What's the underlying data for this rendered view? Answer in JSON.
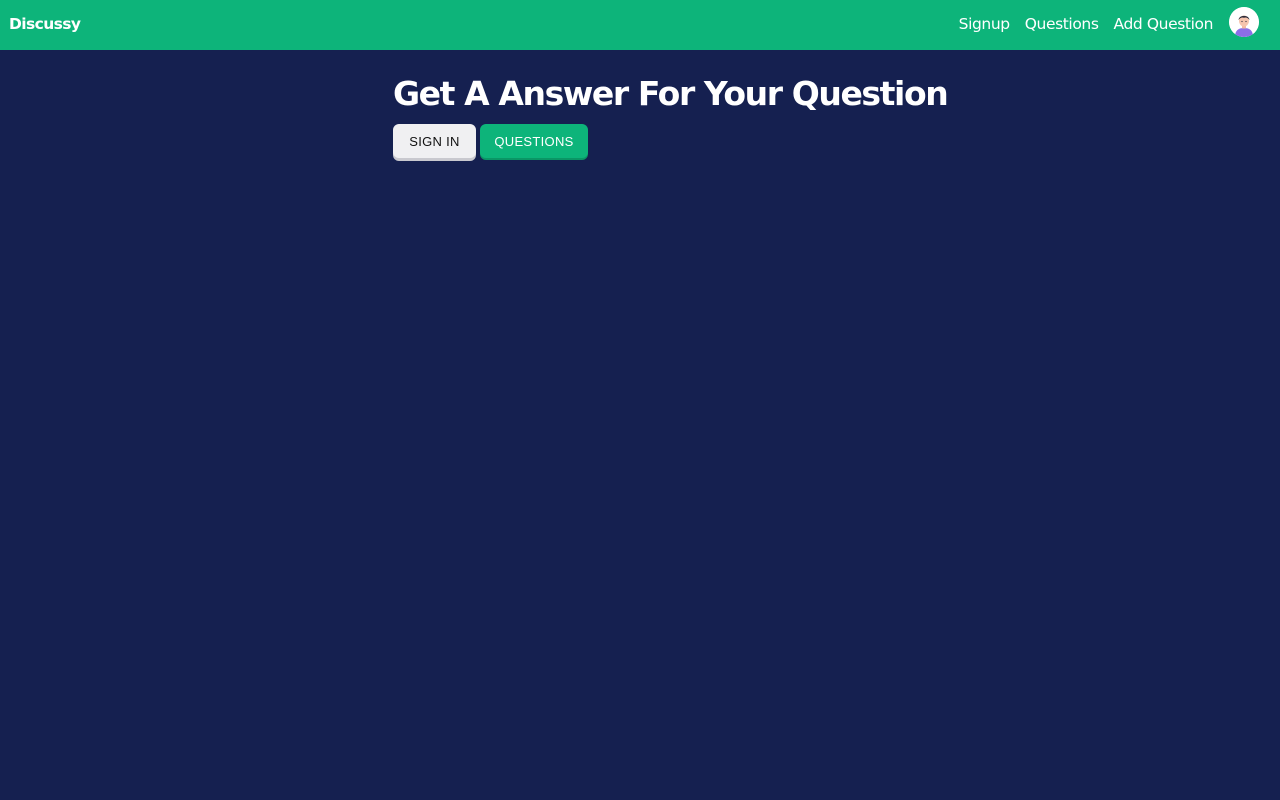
{
  "navbar": {
    "brand": "Discussy",
    "links": [
      {
        "label": "Signup"
      },
      {
        "label": "Questions"
      },
      {
        "label": "Add Question"
      }
    ],
    "avatar_icon": "user-avatar-icon"
  },
  "hero": {
    "title": "Get A Answer For Your Question",
    "signin_label": "SIGN IN",
    "questions_label": "QUESTIONS"
  },
  "colors": {
    "navbar_bg": "#0db47a",
    "page_bg": "#152050",
    "accent": "#0db47a",
    "signin_bg": "#f0f0f2"
  }
}
